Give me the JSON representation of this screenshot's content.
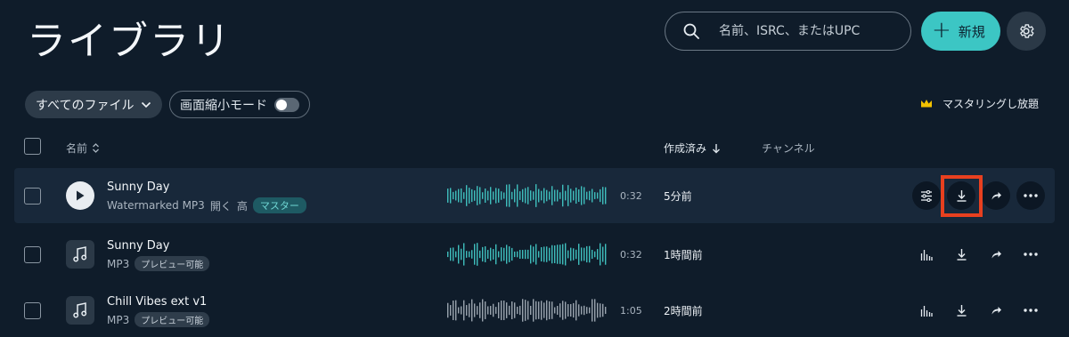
{
  "page": {
    "title": "ライブラリ"
  },
  "search": {
    "placeholder": "名前、ISRC、またはUPC"
  },
  "toolbar": {
    "new_label": "新規",
    "settings_icon": "gear-icon"
  },
  "filters": {
    "file_filter_label": "すべてのファイル",
    "compact_mode_label": "画面縮小モード",
    "compact_mode_on": false,
    "mastering_label": "マスタリングし放題"
  },
  "table": {
    "columns": {
      "name": "名前",
      "created": "作成済み",
      "channel": "チャンネル"
    },
    "rows": [
      {
        "name": "Sunny Day",
        "format": "Watermarked MP3",
        "open": "開く",
        "quality": "高",
        "badge": "マスター",
        "duration": "0:32",
        "created": "5分前",
        "wave_color": "#3fbfbd"
      },
      {
        "name": "Sunny Day",
        "format": "MP3",
        "badge": "プレビュー可能",
        "duration": "0:32",
        "created": "1時間前",
        "wave_color": "#3fbfbd"
      },
      {
        "name": "Chill Vibes ext v1",
        "format": "MP3",
        "badge": "プレビュー可能",
        "duration": "1:05",
        "created": "2時間前",
        "wave_color": "#9aa4ae"
      }
    ]
  },
  "colors": {
    "accent": "#3cc6c4",
    "background": "#0f1c2a",
    "highlight": "#e8401f",
    "crown": "#f2c200"
  }
}
